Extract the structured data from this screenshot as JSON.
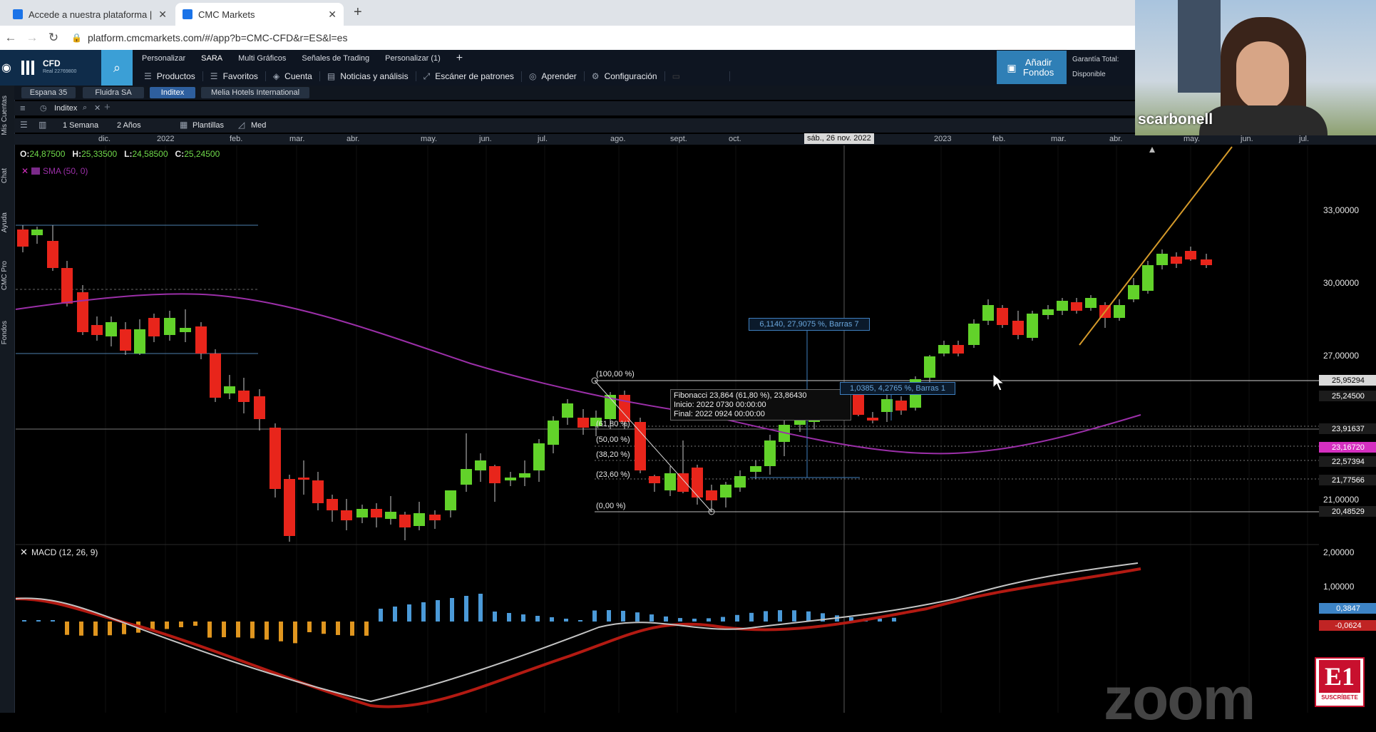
{
  "browser": {
    "tabs": [
      {
        "title": "Accede a nuestra plataforma | CM"
      },
      {
        "title": "CMC Markets"
      }
    ],
    "url": "platform.cmcmarkets.com/#/app?b=CMC-CFD&r=ES&l=es"
  },
  "app": {
    "account_type": "CFD",
    "account_sub": "Real 22769800",
    "top_links": [
      "Personalizar",
      "SARA",
      "Multi Gráficos",
      "Señales de Trading",
      "Personalizar (1)"
    ],
    "menu": [
      "Productos",
      "Favoritos",
      "Cuenta",
      "Noticias y análisis",
      "Escáner de patrones",
      "Aprender",
      "Configuración"
    ],
    "add_funds": "Añadir Fondos",
    "summary_labels": [
      "Garantía Total:",
      "Disponible"
    ],
    "sidebar": [
      "Mis Cuentas",
      "Chat",
      "Ayuda",
      "CMC Pro",
      "Fondos"
    ],
    "instrument_tabs": [
      "Espana 35",
      "Fluidra SA",
      "Inditex",
      "Melia Hotels International"
    ],
    "active_instrument": "Inditex",
    "chart_tab": "Inditex",
    "timeframe": "1 Semana",
    "range": "2 Años",
    "templates_btn": "Plantillas",
    "mode_btn": "Med"
  },
  "chart": {
    "date_labels": [
      "dic.",
      "2022",
      "feb.",
      "mar.",
      "abr.",
      "may.",
      "jun.",
      "jul.",
      "ago.",
      "sept.",
      "oct.",
      "2023",
      "feb.",
      "mar.",
      "abr.",
      "may.",
      "jun.",
      "jul."
    ],
    "crosshair_date": "sáb., 26 nov. 2022",
    "ohlc": {
      "O": "24,87500",
      "H": "25,33500",
      "L": "24,58500",
      "C": "25,24500"
    },
    "sma_label": "SMA (50, 0)",
    "price_labels": [
      "33,00000",
      "30,00000",
      "27,00000",
      "21,00000"
    ],
    "price_boxes": [
      {
        "text": "25,95294",
        "bg": "#d9d9d9",
        "fg": "#000000"
      },
      {
        "text": "25,24500",
        "bg": "#1c1c1c",
        "fg": "#ffffff"
      },
      {
        "text": "23,91637",
        "bg": "#1c1c1c",
        "fg": "#ffffff"
      },
      {
        "text": "23,16720",
        "bg": "#d52fc0",
        "fg": "#ffffff"
      },
      {
        "text": "22,57394",
        "bg": "#1c1c1c",
        "fg": "#ffffff"
      },
      {
        "text": "21,77566",
        "bg": "#1c1c1c",
        "fg": "#ffffff"
      },
      {
        "text": "20,48529",
        "bg": "#1c1c1c",
        "fg": "#ffffff"
      }
    ],
    "fib_levels": [
      "(100,00 %)",
      "(61,80 %)",
      "(50,00 %)",
      "(38,20 %)",
      "(23,60 %)",
      "(0,00 %)"
    ],
    "fib_tooltip": [
      "Fibonacci 23,864 (61,80 %), 23,86430",
      "Inicio: 2022 0730 00:00:00",
      "Final: 2022 0924 00:00:00"
    ],
    "measure1": "6,1140, 27,9075 %, Barras 7",
    "measure2": "1,0385, 4,2765 %, Barras 1",
    "macd_label": "MACD (12, 26, 9)",
    "macd_price_labels": [
      "2,00000",
      "1,00000"
    ],
    "macd_boxes": [
      {
        "text": "0,3847",
        "bg": "#3d84c6"
      },
      {
        "text": "-0,0624",
        "bg": "#c02424"
      }
    ],
    "colors": {
      "up": "#62d22a",
      "down": "#e8251b",
      "sma": "#9b2fa8",
      "hist_up": "#4b9ad8",
      "hist_down": "#e0961f"
    }
  },
  "video": {
    "participant": "scarbonell",
    "brand": "zoom",
    "badge": "SUSCRÍBETE"
  }
}
